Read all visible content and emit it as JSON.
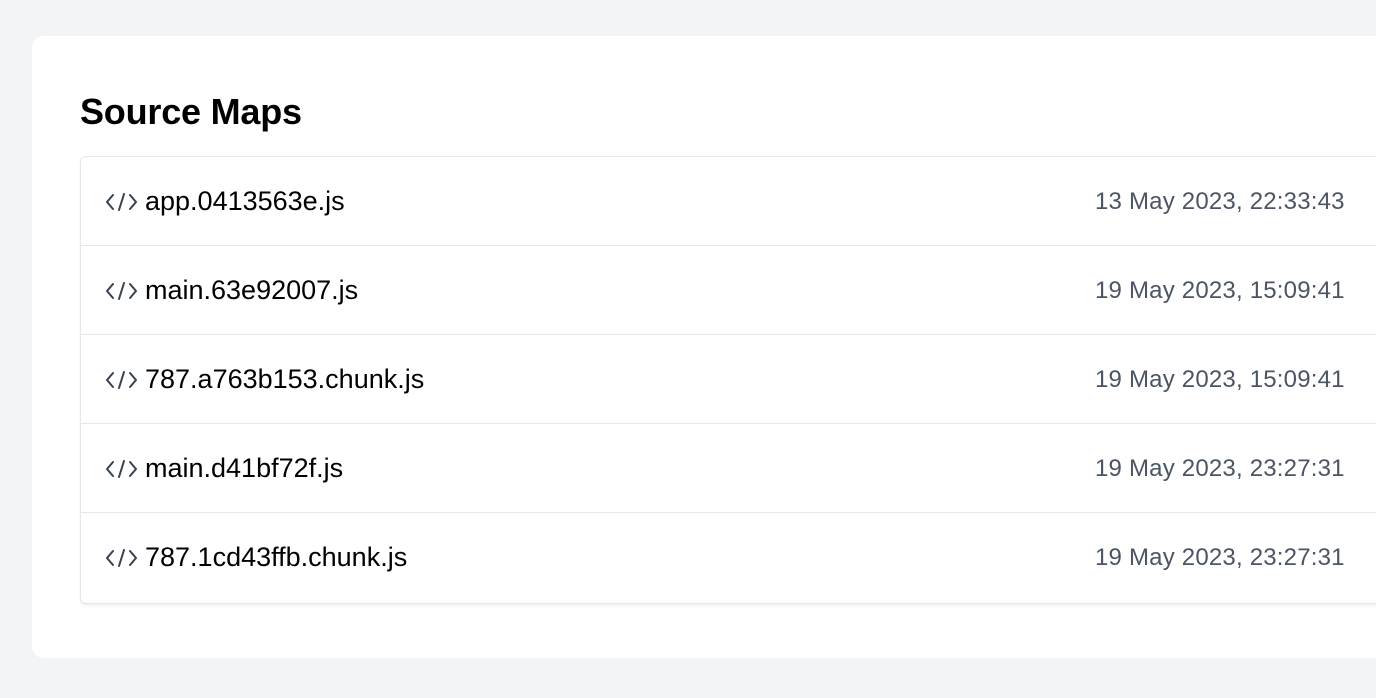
{
  "page": {
    "title": "Source Maps"
  },
  "source_maps": [
    {
      "icon": "code-icon",
      "filename": "app.0413563e.js",
      "date": "13 May 2023, 22:33:43"
    },
    {
      "icon": "code-icon",
      "filename": "main.63e92007.js",
      "date": "19 May 2023, 15:09:41"
    },
    {
      "icon": "code-icon",
      "filename": "787.a763b153.chunk.js",
      "date": "19 May 2023, 15:09:41"
    },
    {
      "icon": "code-icon",
      "filename": "main.d41bf72f.js",
      "date": "19 May 2023, 23:27:31"
    },
    {
      "icon": "code-icon",
      "filename": "787.1cd43ffb.chunk.js",
      "date": "19 May 2023, 23:27:31"
    }
  ]
}
